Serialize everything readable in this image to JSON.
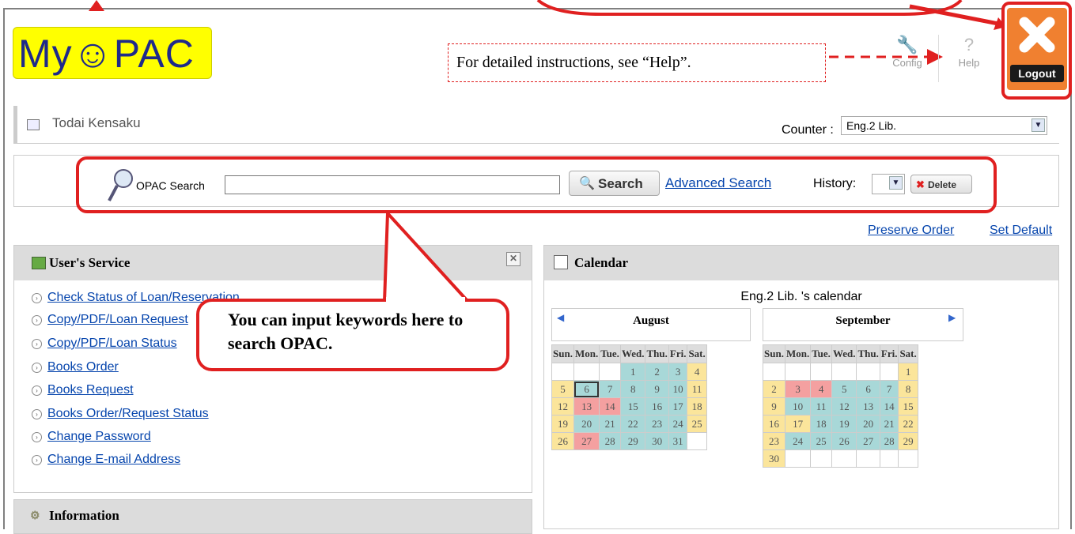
{
  "header": {
    "logo_text": "My☺PAC",
    "note": "For detailed instructions, see “Help”.",
    "config_label": "Config",
    "help_label": "Help",
    "logout_label": "Logout"
  },
  "service_bar": {
    "title": "Todai Kensaku",
    "counter_label": "Counter :",
    "counter_value": "Eng.2 Lib."
  },
  "search": {
    "label": "OPAC Search",
    "input_value": "",
    "search_button": "Search",
    "advanced_link": "Advanced Search",
    "history_label": "History:",
    "history_value": "",
    "delete_button": "Delete"
  },
  "layout_links": {
    "preserve_order": "Preserve Order",
    "set_default": "Set Default"
  },
  "users_service": {
    "title": "User's Service",
    "items": [
      "Check Status of Loan/Reservation",
      "Copy/PDF/Loan Request",
      "Copy/PDF/Loan Status",
      "Books Order",
      "Books Request",
      "Books Order/Request Status",
      "Change Password",
      "Change E-mail Address"
    ]
  },
  "information": {
    "title": "Information"
  },
  "calendar": {
    "title": "Calendar",
    "caption": "Eng.2 Lib. 's calendar",
    "weekdays": [
      "Sun.",
      "Mon.",
      "Tue.",
      "Wed.",
      "Thu.",
      "Fri.",
      "Sat."
    ],
    "months": [
      {
        "name": "August",
        "weeks": [
          [
            [
              "",
              ""
            ],
            [
              "",
              ""
            ],
            [
              "",
              ""
            ],
            [
              "1",
              "cy"
            ],
            [
              "2",
              "cy"
            ],
            [
              "3",
              "cy"
            ],
            [
              "4",
              "yl"
            ]
          ],
          [
            [
              "5",
              "yl"
            ],
            [
              "6",
              "cy"
            ],
            [
              "7",
              "cy"
            ],
            [
              "8",
              "cy"
            ],
            [
              "9",
              "cy"
            ],
            [
              "10",
              "cy"
            ],
            [
              "11",
              "yl"
            ]
          ],
          [
            [
              "12",
              "yl"
            ],
            [
              "13",
              "rd"
            ],
            [
              "14",
              "rd"
            ],
            [
              "15",
              "cy"
            ],
            [
              "16",
              "cy"
            ],
            [
              "17",
              "cy"
            ],
            [
              "18",
              "yl"
            ]
          ],
          [
            [
              "19",
              "yl"
            ],
            [
              "20",
              "cy"
            ],
            [
              "21",
              "cy"
            ],
            [
              "22",
              "cy"
            ],
            [
              "23",
              "cy"
            ],
            [
              "24",
              "cy"
            ],
            [
              "25",
              "yl"
            ]
          ],
          [
            [
              "26",
              "yl"
            ],
            [
              "27",
              "rd"
            ],
            [
              "28",
              "cy"
            ],
            [
              "29",
              "cy"
            ],
            [
              "30",
              "cy"
            ],
            [
              "31",
              "cy"
            ],
            [
              "",
              "em"
            ]
          ]
        ],
        "today": "6"
      },
      {
        "name": "September",
        "weeks": [
          [
            [
              "",
              ""
            ],
            [
              "",
              ""
            ],
            [
              "",
              ""
            ],
            [
              "",
              ""
            ],
            [
              "",
              ""
            ],
            [
              "",
              ""
            ],
            [
              "1",
              "yl"
            ]
          ],
          [
            [
              "2",
              "yl"
            ],
            [
              "3",
              "rd"
            ],
            [
              "4",
              "rd"
            ],
            [
              "5",
              "cy"
            ],
            [
              "6",
              "cy"
            ],
            [
              "7",
              "cy"
            ],
            [
              "8",
              "yl"
            ]
          ],
          [
            [
              "9",
              "yl"
            ],
            [
              "10",
              "cy"
            ],
            [
              "11",
              "cy"
            ],
            [
              "12",
              "cy"
            ],
            [
              "13",
              "cy"
            ],
            [
              "14",
              "cy"
            ],
            [
              "15",
              "yl"
            ]
          ],
          [
            [
              "16",
              "yl"
            ],
            [
              "17",
              "yl"
            ],
            [
              "18",
              "cy"
            ],
            [
              "19",
              "cy"
            ],
            [
              "20",
              "cy"
            ],
            [
              "21",
              "cy"
            ],
            [
              "22",
              "yl"
            ]
          ],
          [
            [
              "23",
              "yl"
            ],
            [
              "24",
              "cy"
            ],
            [
              "25",
              "cy"
            ],
            [
              "26",
              "cy"
            ],
            [
              "27",
              "cy"
            ],
            [
              "28",
              "cy"
            ],
            [
              "29",
              "yl"
            ]
          ],
          [
            [
              "30",
              "yl"
            ],
            [
              "",
              "em"
            ],
            [
              "",
              "em"
            ],
            [
              "",
              "em"
            ],
            [
              "",
              "em"
            ],
            [
              "",
              "em"
            ],
            [
              "",
              "em"
            ]
          ]
        ],
        "today": ""
      }
    ]
  },
  "callout": {
    "text": "You can input keywords here to search OPAC."
  },
  "colors": {
    "highlight": "#e02020",
    "link": "#0645ad",
    "open": "#a8d8d8",
    "weekend": "#fbe59b",
    "closed": "#f4a0a0"
  }
}
